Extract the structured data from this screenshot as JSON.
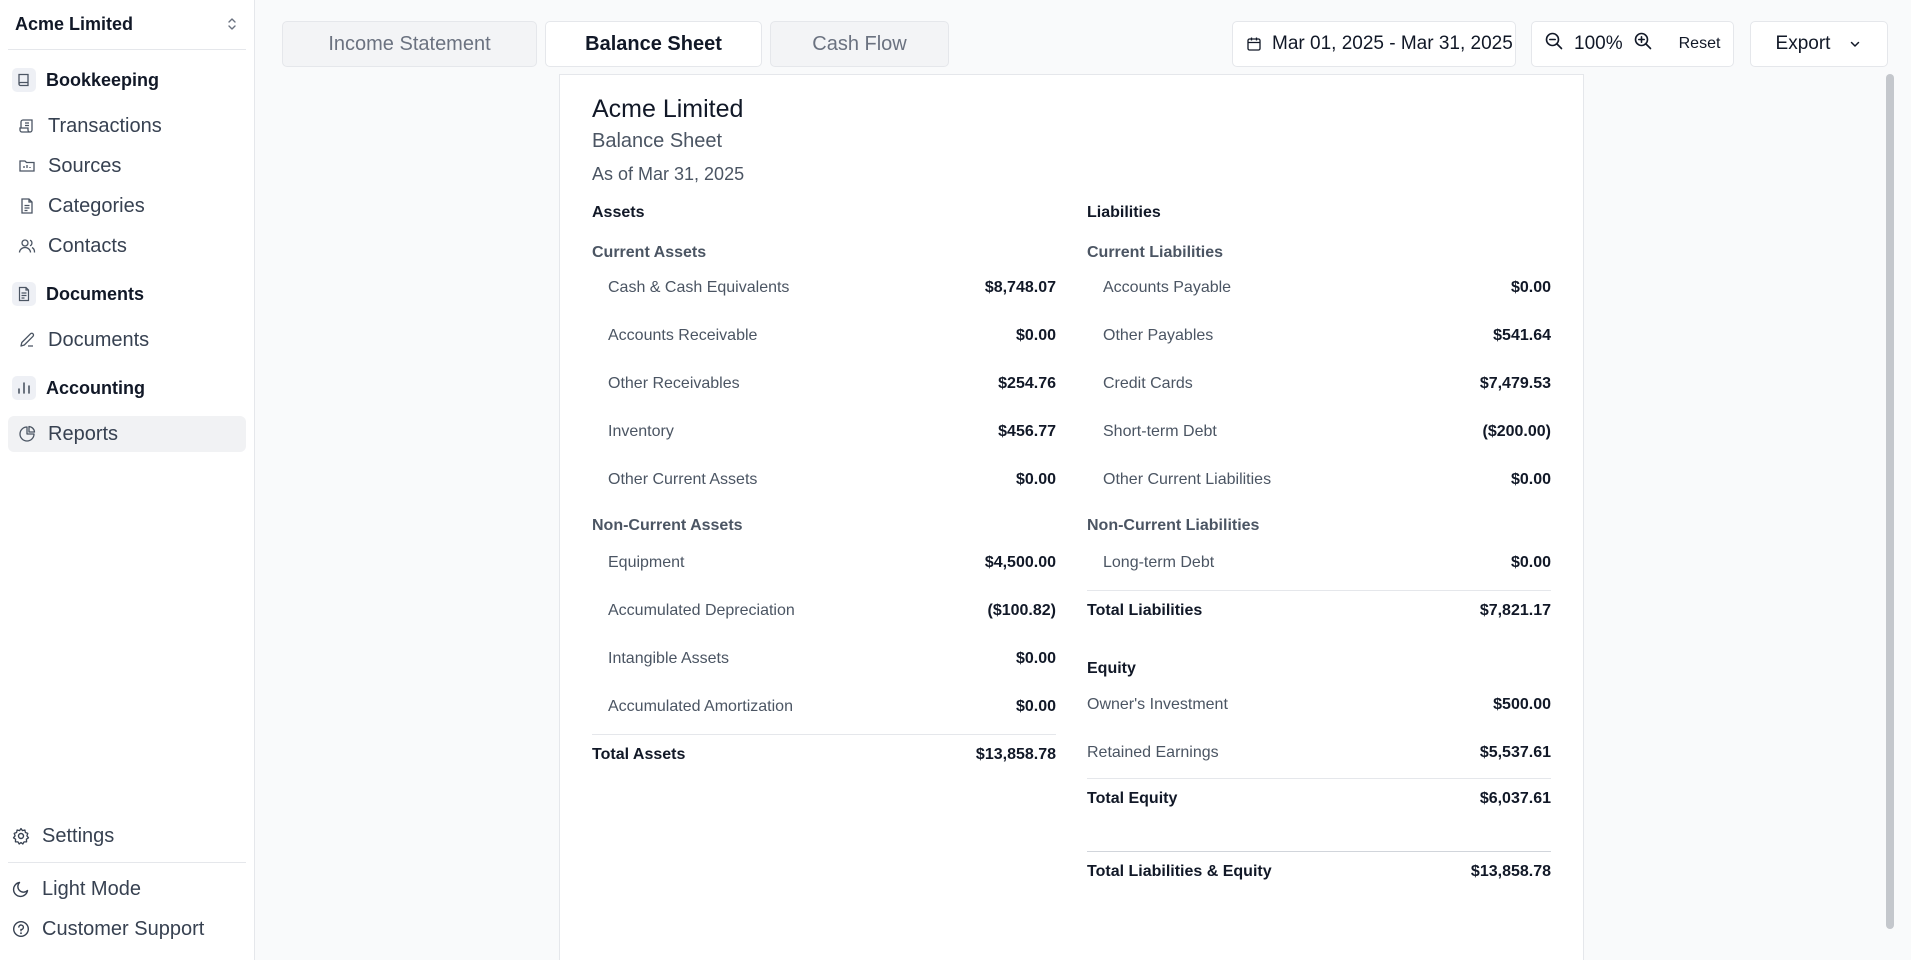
{
  "sidebar": {
    "org_name": "Acme Limited",
    "sections": [
      {
        "label": "Bookkeeping",
        "icon": "book-icon",
        "items": [
          {
            "label": "Transactions",
            "icon": "scroll-icon"
          },
          {
            "label": "Sources",
            "icon": "folder-icon"
          },
          {
            "label": "Categories",
            "icon": "file-icon"
          },
          {
            "label": "Contacts",
            "icon": "users-icon"
          }
        ]
      },
      {
        "label": "Documents",
        "icon": "file-text-icon",
        "items": [
          {
            "label": "Documents",
            "icon": "pencil-icon"
          }
        ]
      },
      {
        "label": "Accounting",
        "icon": "bar-chart-icon",
        "items": [
          {
            "label": "Reports",
            "icon": "pie-chart-icon",
            "active": true
          }
        ]
      }
    ],
    "settings_label": "Settings",
    "theme_label": "Light Mode",
    "support_label": "Customer Support"
  },
  "toolbar": {
    "tabs": [
      {
        "label": "Income Statement",
        "active": false
      },
      {
        "label": "Balance Sheet",
        "active": true
      },
      {
        "label": "Cash Flow",
        "active": false
      }
    ],
    "date_range": "Mar 01, 2025 - Mar 31, 2025",
    "zoom_level": "100%",
    "reset_label": "Reset",
    "export_label": "Export"
  },
  "report": {
    "company": "Acme Limited",
    "title": "Balance Sheet",
    "as_of": "As of Mar 31, 2025",
    "assets": {
      "heading": "Assets",
      "current_heading": "Current Assets",
      "current": [
        {
          "label": "Cash & Cash Equivalents",
          "value": "$8,748.07"
        },
        {
          "label": "Accounts Receivable",
          "value": "$0.00"
        },
        {
          "label": "Other Receivables",
          "value": "$254.76"
        },
        {
          "label": "Inventory",
          "value": "$456.77"
        },
        {
          "label": "Other Current Assets",
          "value": "$0.00"
        }
      ],
      "noncurrent_heading": "Non-Current Assets",
      "noncurrent": [
        {
          "label": "Equipment",
          "value": "$4,500.00"
        },
        {
          "label": "Accumulated Depreciation",
          "value": "($100.82)"
        },
        {
          "label": "Intangible Assets",
          "value": "$0.00"
        },
        {
          "label": "Accumulated Amortization",
          "value": "$0.00"
        }
      ],
      "total_label": "Total Assets",
      "total_value": "$13,858.78"
    },
    "liabilities": {
      "heading": "Liabilities",
      "current_heading": "Current Liabilities",
      "current": [
        {
          "label": "Accounts Payable",
          "value": "$0.00"
        },
        {
          "label": "Other Payables",
          "value": "$541.64"
        },
        {
          "label": "Credit Cards",
          "value": "$7,479.53"
        },
        {
          "label": "Short-term Debt",
          "value": "($200.00)"
        },
        {
          "label": "Other Current Liabilities",
          "value": "$0.00"
        }
      ],
      "noncurrent_heading": "Non-Current Liabilities",
      "noncurrent": [
        {
          "label": "Long-term Debt",
          "value": "$0.00"
        }
      ],
      "total_label": "Total Liabilities",
      "total_value": "$7,821.17"
    },
    "equity": {
      "heading": "Equity",
      "items": [
        {
          "label": "Owner's Investment",
          "value": "$500.00"
        },
        {
          "label": "Retained Earnings",
          "value": "$5,537.61"
        }
      ],
      "total_label": "Total Equity",
      "total_value": "$6,037.61"
    },
    "grand_total_label": "Total Liabilities & Equity",
    "grand_total_value": "$13,858.78"
  }
}
